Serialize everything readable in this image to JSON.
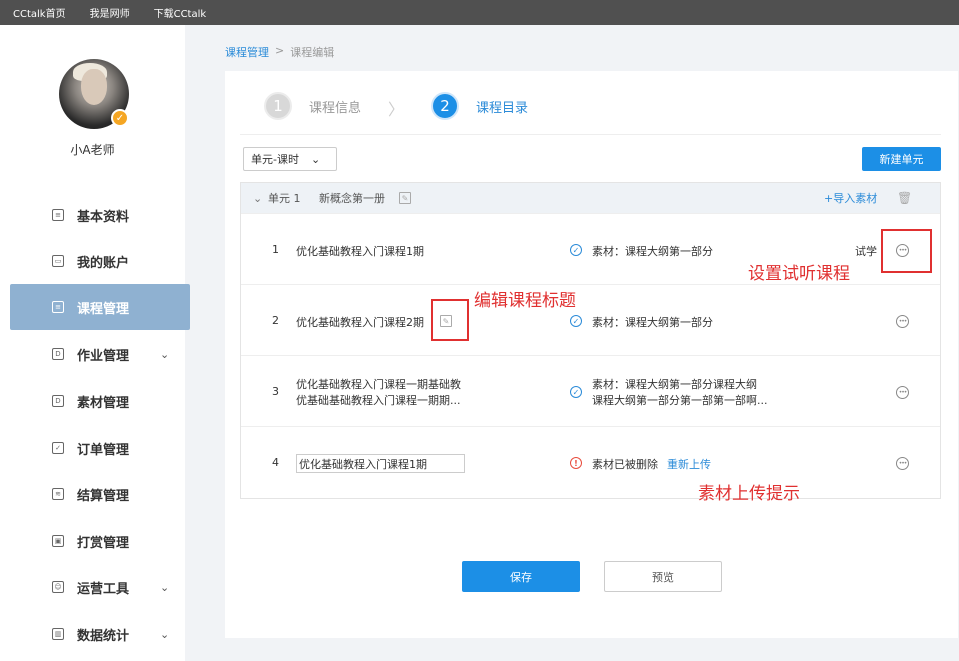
{
  "topbar": {
    "links": [
      "CCtalk首页",
      "我是网师",
      "下载CCtalk"
    ]
  },
  "user": {
    "name": "小A老师",
    "badge": "✓"
  },
  "sidebar": {
    "items": [
      {
        "label": "基本资料",
        "icon": "profile-icon",
        "glyph": "≡",
        "chevron": ""
      },
      {
        "label": "我的账户",
        "icon": "account-card-icon",
        "glyph": "▭",
        "chevron": ""
      },
      {
        "label": "课程管理",
        "icon": "course-icon",
        "glyph": "≡",
        "chevron": ""
      },
      {
        "label": "作业管理",
        "icon": "homework-icon",
        "glyph": "D",
        "chevron": "⌄"
      },
      {
        "label": "素材管理",
        "icon": "material-icon",
        "glyph": "D",
        "chevron": ""
      },
      {
        "label": "订单管理",
        "icon": "order-icon",
        "glyph": "✓",
        "chevron": ""
      },
      {
        "label": "结算管理",
        "icon": "settlement-icon",
        "glyph": "≋",
        "chevron": ""
      },
      {
        "label": "打赏管理",
        "icon": "reward-icon",
        "glyph": "▣",
        "chevron": ""
      },
      {
        "label": "运营工具",
        "icon": "operation-icon",
        "glyph": "☺",
        "chevron": "⌄"
      },
      {
        "label": "数据统计",
        "icon": "statistics-icon",
        "glyph": "▥",
        "chevron": "⌄"
      }
    ],
    "active": "课程管理"
  },
  "breadcrumb": {
    "parent": "课程管理",
    "sep": ">",
    "current": "课程编辑"
  },
  "steps": [
    {
      "num": "1",
      "label": "课程信息"
    },
    {
      "num": "2",
      "label": "课程目录"
    }
  ],
  "step_arrow": "〉",
  "toolbar": {
    "select_value": "单元-课时",
    "select_chevron": "⌄",
    "new_unit": "新建单元"
  },
  "unit": {
    "chevron": "⌄",
    "name": "单元 1",
    "title": "新概念第一册",
    "edit_glyph": "✎",
    "import": "+导入素材",
    "trash_glyph": "🗑"
  },
  "lessons": [
    {
      "num": "1",
      "title": "优化基础教程入门课程1期",
      "status_glyph": "✓",
      "material": "素材：课程大纲第一部分",
      "trial": "试学",
      "more": "•••"
    },
    {
      "num": "2",
      "title": "优化基础教程入门课程2期",
      "edit_glyph": "✎",
      "status_glyph": "✓",
      "material": "素材：课程大纲第一部分",
      "more": "•••"
    },
    {
      "num": "3",
      "title_line1": "优化基础教程入门课程一期基础教",
      "title_line2": "优基础基础教程入门课程一期期...",
      "status_glyph": "✓",
      "material_line1": "素材：课程大纲第一部分课程大纲",
      "material_line2": "课程大纲第一部分第一部第一部啊...",
      "more": "•••"
    },
    {
      "num": "4",
      "title_input": "优化基础教程入门课程1期",
      "status_glyph": "!",
      "material": "素材已被删除",
      "reupload": "重新上传",
      "more": "•••"
    }
  ],
  "annotations": {
    "trial": "设置试听课程",
    "edit_title": "编辑课程标题",
    "upload_tip": "素材上传提示"
  },
  "actions": {
    "save": "保存",
    "preview": "预览"
  },
  "colors": {
    "accent": "#1c8fe6",
    "active_menu": "#8fb1d1",
    "annotation": "#e03030",
    "warn": "#e84c3d",
    "topbar": "#505050"
  }
}
